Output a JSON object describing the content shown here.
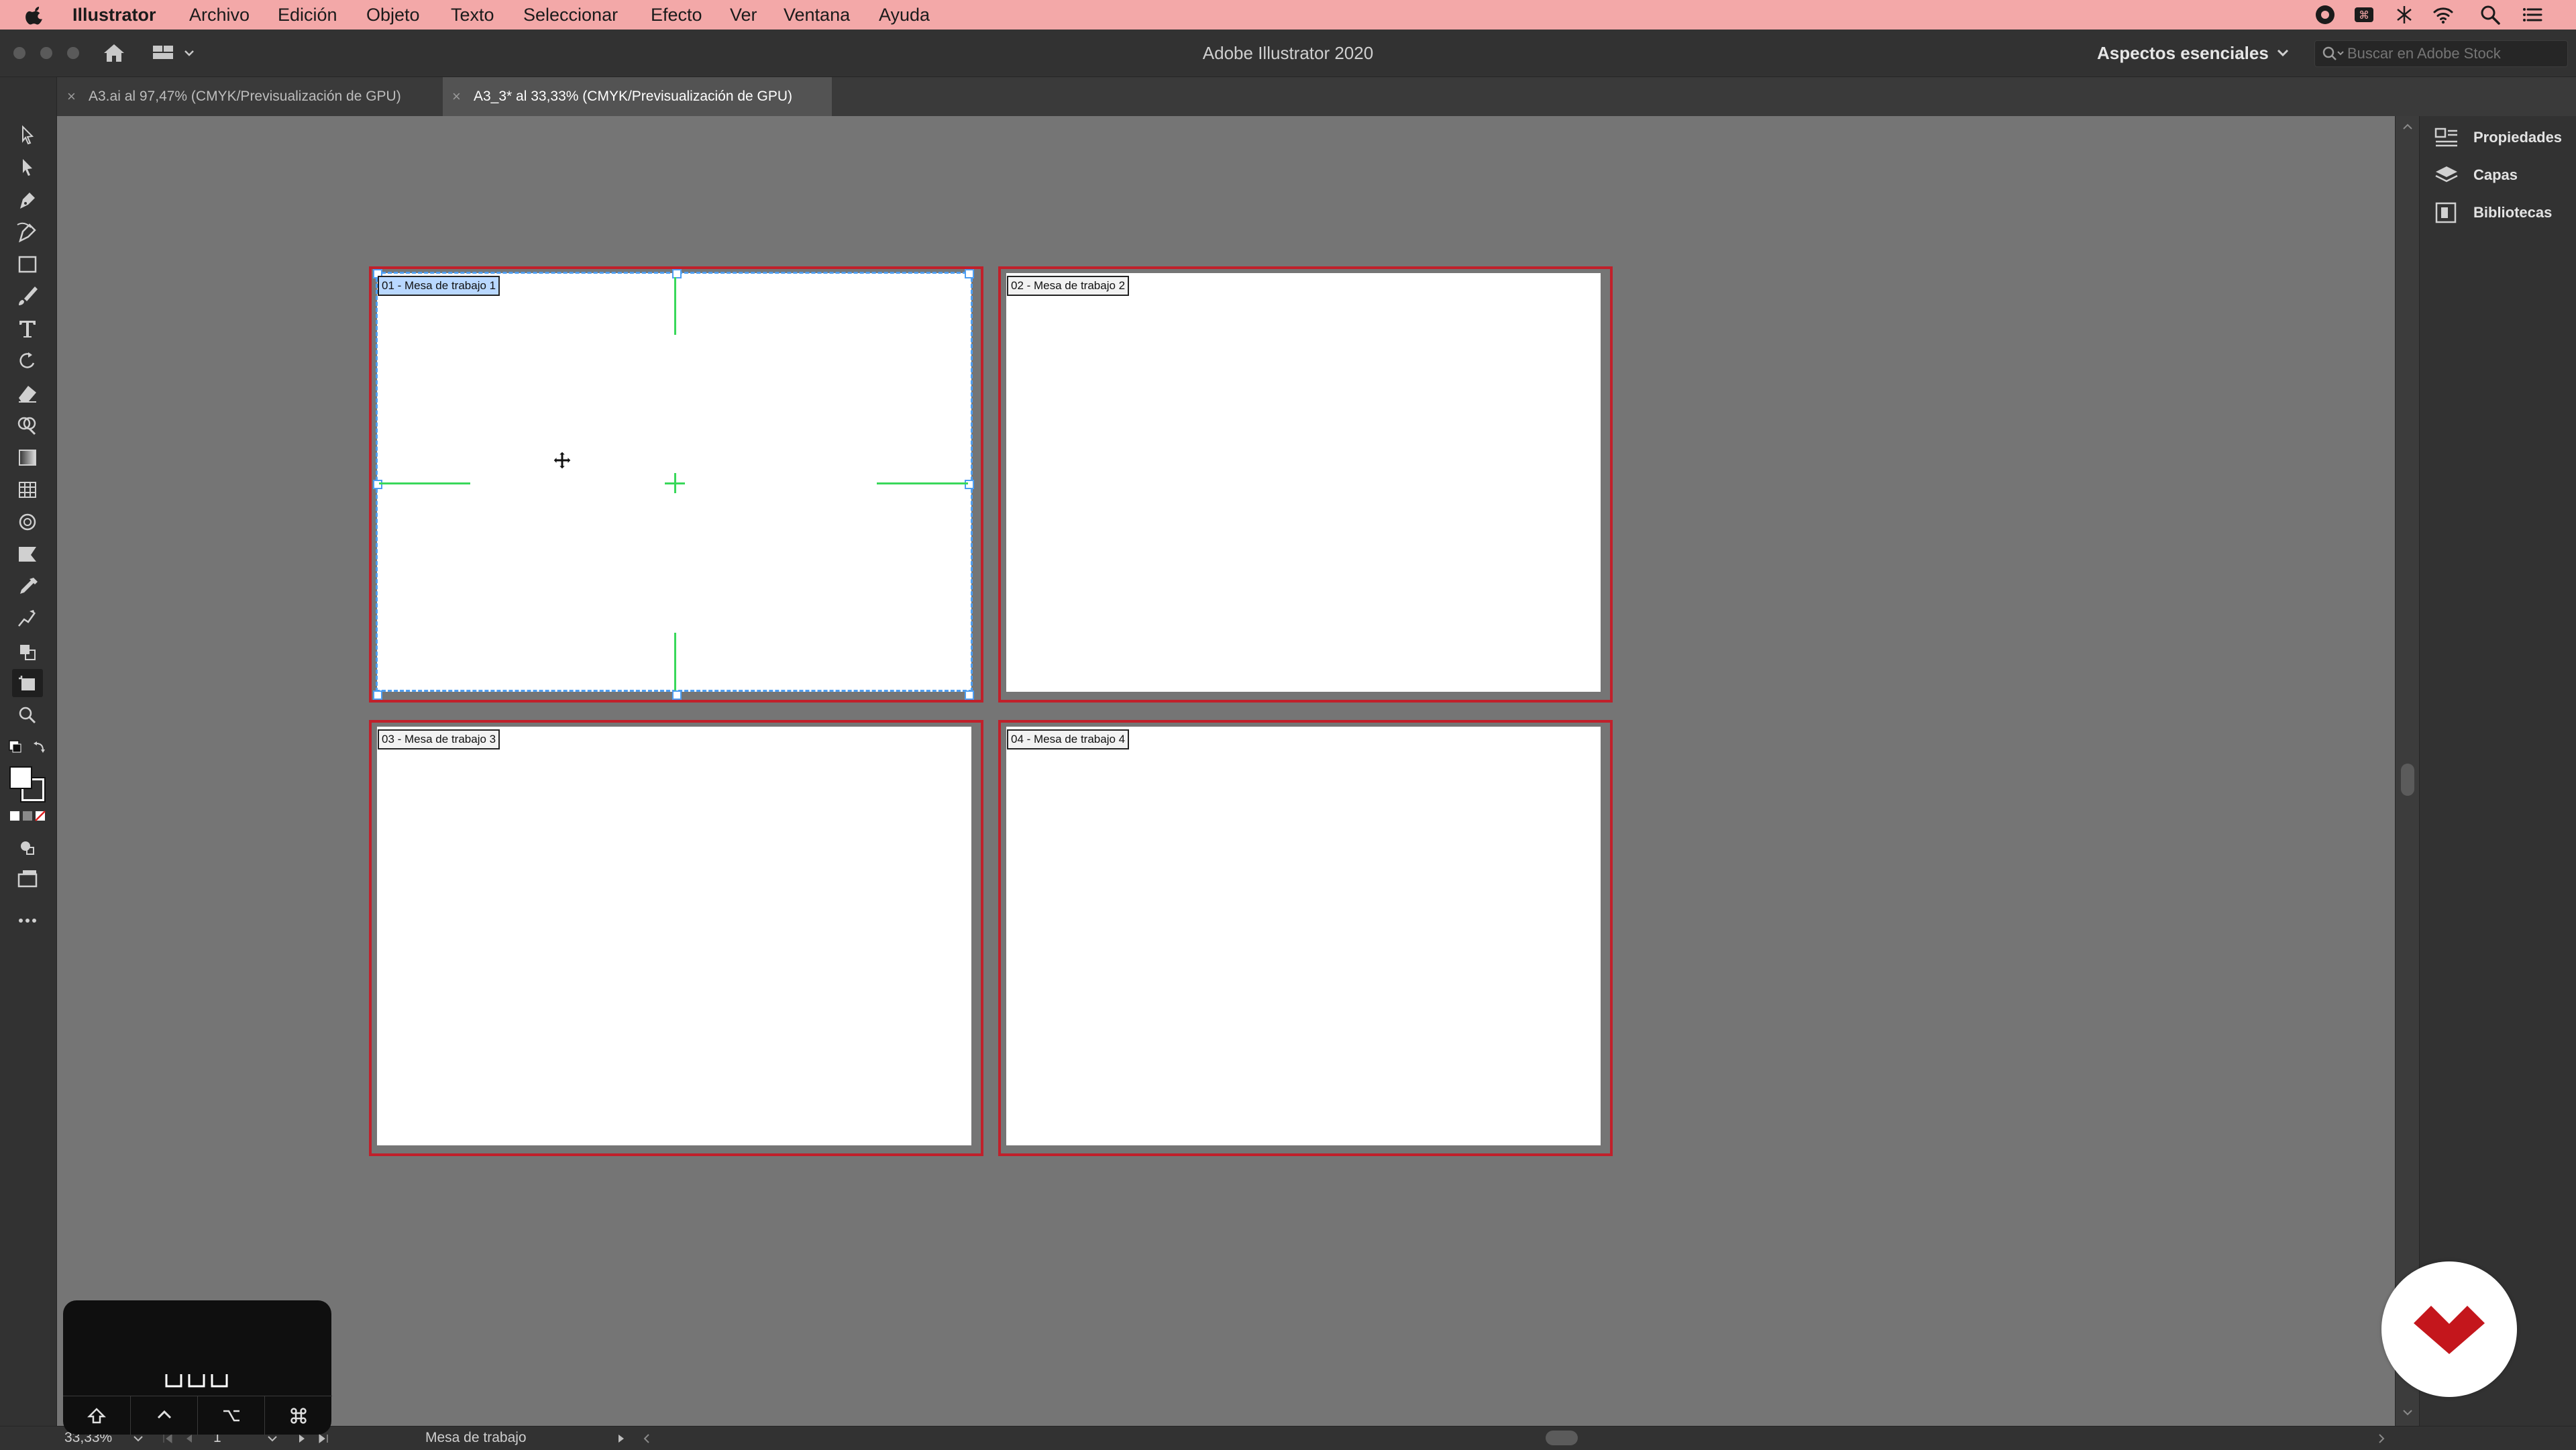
{
  "menubar": {
    "app_name": "Illustrator",
    "items": [
      "Archivo",
      "Edición",
      "Objeto",
      "Texto",
      "Seleccionar",
      "Efecto",
      "Ver",
      "Ventana",
      "Ayuda"
    ]
  },
  "window": {
    "title": "Adobe Illustrator 2020",
    "workspace": "Aspectos esenciales",
    "stock_search_placeholder": "Buscar en Adobe Stock"
  },
  "tabs": [
    {
      "label": "A3.ai al 97,47% (CMYK/Previsualización de GPU)",
      "active": false
    },
    {
      "label": "A3_3* al 33,33% (CMYK/Previsualización de GPU)",
      "active": true
    }
  ],
  "artboards": [
    {
      "label": "01 - Mesa de trabajo 1",
      "selected": true
    },
    {
      "label": "02 - Mesa de trabajo 2",
      "selected": false
    },
    {
      "label": "03 - Mesa de trabajo 3",
      "selected": false
    },
    {
      "label": "04 - Mesa de trabajo 4",
      "selected": false
    }
  ],
  "panels": [
    "Propiedades",
    "Capas",
    "Bibliotecas"
  ],
  "status": {
    "zoom": "33,33%",
    "artboard_number": "1",
    "label": "Mesa de trabajo"
  },
  "colors": {
    "menubar_bg": "#f3a8a8",
    "canvas_bg": "#757575",
    "artboard_border": "#c0202b",
    "selection_blue": "#4d9ef2",
    "guide_green": "#39d85a",
    "logo_red": "#c4161c"
  }
}
